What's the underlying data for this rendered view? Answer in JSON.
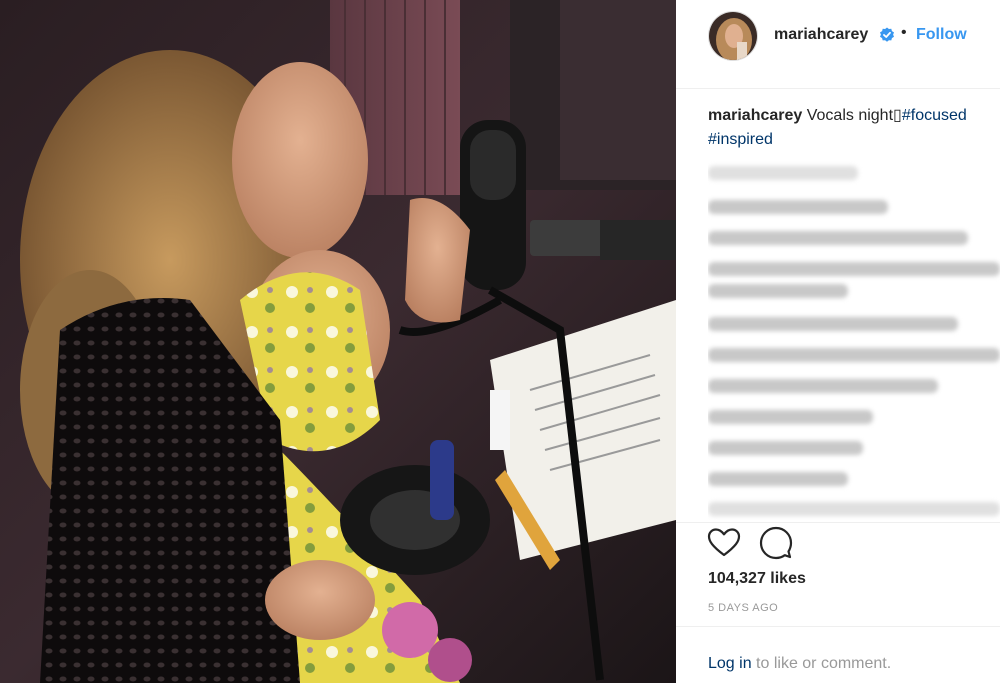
{
  "post": {
    "username": "mariahcarey",
    "follow_label": "Follow",
    "dot_separator": "•",
    "caption_user": "mariahcarey",
    "caption_text": " Vocals night",
    "caption_glyph": "▯",
    "hashtags": [
      "#focused",
      "#inspired"
    ],
    "likes": "104,327 likes",
    "time_ago": "5 DAYS AGO",
    "login_link": "Log in",
    "login_suffix": " to like or comment."
  },
  "colors": {
    "link_blue": "#3897f0",
    "hashtag_blue": "#003569",
    "text": "#262626",
    "muted": "#999999",
    "verified": "#3897f0"
  },
  "icons": {
    "verified": "verified-badge-icon",
    "like": "heart-icon",
    "comment": "speech-bubble-icon"
  }
}
